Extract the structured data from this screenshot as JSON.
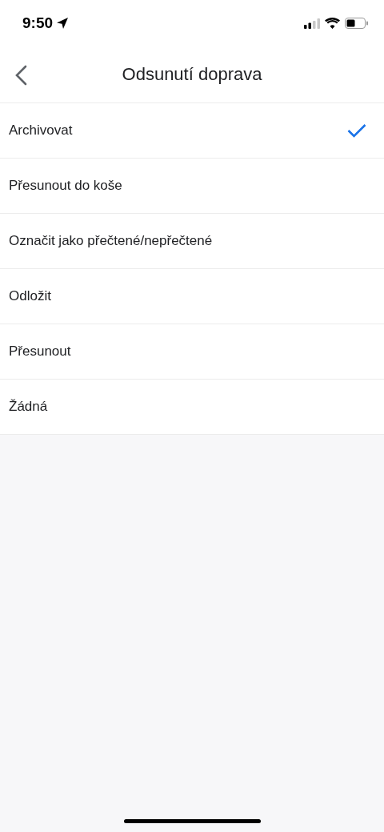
{
  "status_bar": {
    "time": "9:50"
  },
  "header": {
    "title": "Odsunutí doprava"
  },
  "options": [
    {
      "label": "Archivovat",
      "selected": true
    },
    {
      "label": "Přesunout do koše",
      "selected": false
    },
    {
      "label": "Označit jako přečtené/nepřečtené",
      "selected": false
    },
    {
      "label": "Odložit",
      "selected": false
    },
    {
      "label": "Přesunout",
      "selected": false
    },
    {
      "label": "Žádná",
      "selected": false
    }
  ]
}
